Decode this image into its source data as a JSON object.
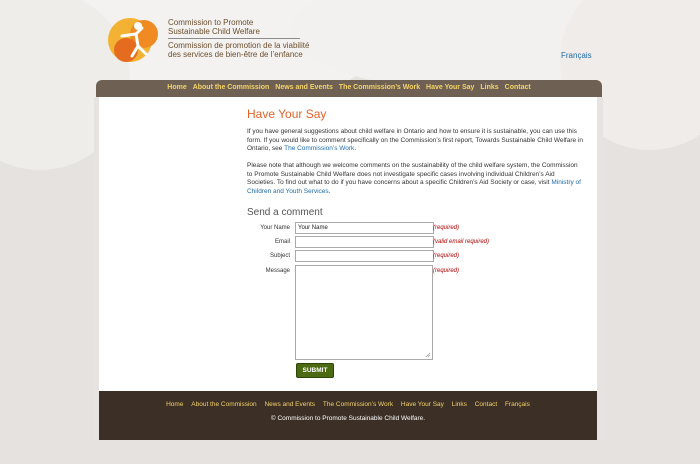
{
  "header": {
    "logo_en_line1": "Commission to Promote",
    "logo_en_line2": "Sustainable Child Welfare",
    "logo_fr_line1": "Commission de promotion de la viabilité",
    "logo_fr_line2": "des services de bien-être de l’enfance",
    "lang_link": "Français"
  },
  "nav": {
    "items": [
      "Home",
      "About the Commission",
      "News and Events",
      "The Commission’s Work",
      "Have Your Say",
      "Links",
      "Contact"
    ]
  },
  "main": {
    "title": "Have Your Say",
    "para1_text": "If you have general suggestions about child welfare in Ontario and how to ensure it is sustainable, you can use this form. If you would like to comment specifically on the Commission’s first report, Towards Sustainable Child Welfare in Ontario, see ",
    "para1_link": "The Commission’s Work",
    "para1_end": ".",
    "para2_text": "Please note that although we welcome comments on the sustainability of the child welfare system, the Commission to Promote Sustainable Child Welfare does not investigate specific cases involving individual Children’s Aid Societies. To find out what to do if you have concerns about a specific Children’s Aid Society or case, visit ",
    "para2_link": "Ministry of Children and Youth Services",
    "para2_end": ".",
    "send_heading": "Send a comment"
  },
  "form": {
    "name_label": "Your Name",
    "name_value": "Your Name",
    "name_req": "(required)",
    "email_label": "Email",
    "email_value": "",
    "email_req": "(valid email required)",
    "subject_label": "Subject",
    "subject_value": "",
    "subject_req": "(required)",
    "message_label": "Message",
    "message_value": "",
    "message_req": "(required)",
    "submit_label": "SUBMIT"
  },
  "footer": {
    "links": [
      "Home",
      "About the Commission",
      "News and Events",
      "The Commission’s Work",
      "Have Your Say",
      "Links",
      "Contact",
      "Français"
    ],
    "copyright": "© Commission to Promote Sustainable Child Welfare."
  },
  "colors": {
    "accent_orange": "#e0622a",
    "nav_bg": "#6e6153",
    "nav_text": "#f5d36a",
    "footer_bg": "#3b2f26",
    "submit_bg": "#4b6a12",
    "link_blue": "#1e6aa8",
    "required_red": "#b00000"
  }
}
